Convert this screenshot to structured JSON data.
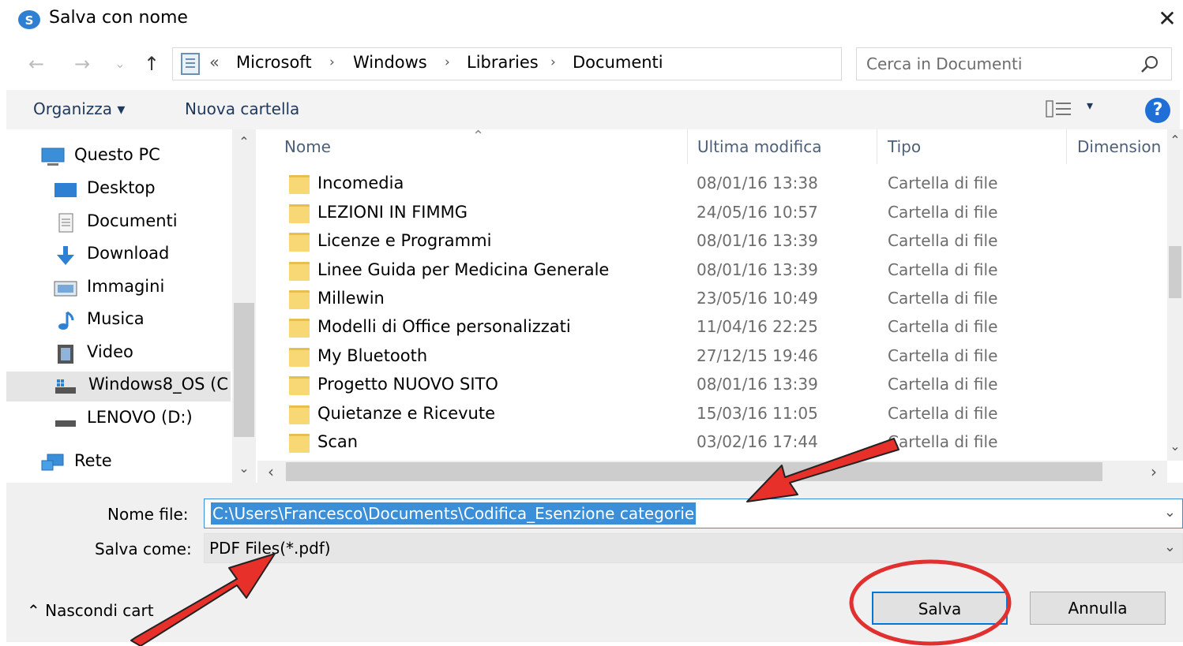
{
  "window": {
    "title": "Salva con nome",
    "close_glyph": "✕"
  },
  "navigation": {
    "back_glyph": "←",
    "forward_glyph": "→",
    "recent_glyph": "⌄",
    "up_glyph": "↑",
    "breadcrumb_prefix": "«",
    "breadcrumbs": [
      "Microsoft",
      "Windows",
      "Libraries",
      "Documenti"
    ],
    "separator": "›",
    "dropdown_glyph": "⌄",
    "refresh_glyph": "↻"
  },
  "search": {
    "placeholder": "Cerca in Documenti"
  },
  "toolbar": {
    "organize_label": "Organizza ▾",
    "new_folder_label": "Nuova cartella",
    "view_caret": "▾",
    "help_glyph": "?"
  },
  "sidebar": {
    "items": [
      {
        "label": "Questo PC",
        "icon": "computer-icon"
      },
      {
        "label": "Desktop",
        "icon": "desktop-icon"
      },
      {
        "label": "Documenti",
        "icon": "documents-icon"
      },
      {
        "label": "Download",
        "icon": "download-icon"
      },
      {
        "label": "Immagini",
        "icon": "pictures-icon"
      },
      {
        "label": "Musica",
        "icon": "music-icon"
      },
      {
        "label": "Video",
        "icon": "video-icon"
      },
      {
        "label": "Windows8_OS (C",
        "icon": "drive-c-icon"
      },
      {
        "label": "LENOVO (D:)",
        "icon": "drive-d-icon"
      },
      {
        "label": "Rete",
        "icon": "network-icon"
      }
    ],
    "selected_index": 7,
    "scroll_up": "⌃",
    "scroll_down": "⌄"
  },
  "file_list": {
    "columns": [
      "Nome",
      "Ultima modifica",
      "Tipo",
      "Dimension"
    ],
    "sort_glyph": "⌃",
    "rows": [
      {
        "name": "Incomedia",
        "modified": "08/01/16 13:38",
        "type": "Cartella di file"
      },
      {
        "name": "LEZIONI IN FIMMG",
        "modified": "24/05/16 10:57",
        "type": "Cartella di file"
      },
      {
        "name": "Licenze e Programmi",
        "modified": "08/01/16 13:39",
        "type": "Cartella di file"
      },
      {
        "name": "Linee Guida per Medicina Generale",
        "modified": "08/01/16 13:39",
        "type": "Cartella di file"
      },
      {
        "name": "Millewin",
        "modified": "23/05/16 10:49",
        "type": "Cartella di file"
      },
      {
        "name": "Modelli di Office personalizzati",
        "modified": "11/04/16 22:25",
        "type": "Cartella di file"
      },
      {
        "name": "My Bluetooth",
        "modified": "27/12/15 19:46",
        "type": "Cartella di file"
      },
      {
        "name": "Progetto NUOVO SITO",
        "modified": "08/01/16 13:39",
        "type": "Cartella di file"
      },
      {
        "name": "Quietanze e Ricevute",
        "modified": "15/03/16 11:05",
        "type": "Cartella di file"
      },
      {
        "name": "Scan",
        "modified": "03/02/16 17:44",
        "type": "Cartella di file"
      }
    ],
    "scroll_left": "‹",
    "scroll_right": "›",
    "scroll_up": "⌃",
    "scroll_down": "⌄"
  },
  "save_form": {
    "filename_label": "Nome file:",
    "filename_value": "C:\\Users\\Francesco\\Documents\\Codifica_Esenzione categorie",
    "savetype_label": "Salva come:",
    "savetype_value": "PDF Files(*.pdf)",
    "dropdown_glyph": "⌄",
    "hide_folders_label": "⌃  Nascondi cart",
    "save_button": "Salva",
    "cancel_button": "Annulla"
  },
  "annotations": {
    "arrow_color": "#e8302a",
    "circle_color": "#e03030"
  }
}
